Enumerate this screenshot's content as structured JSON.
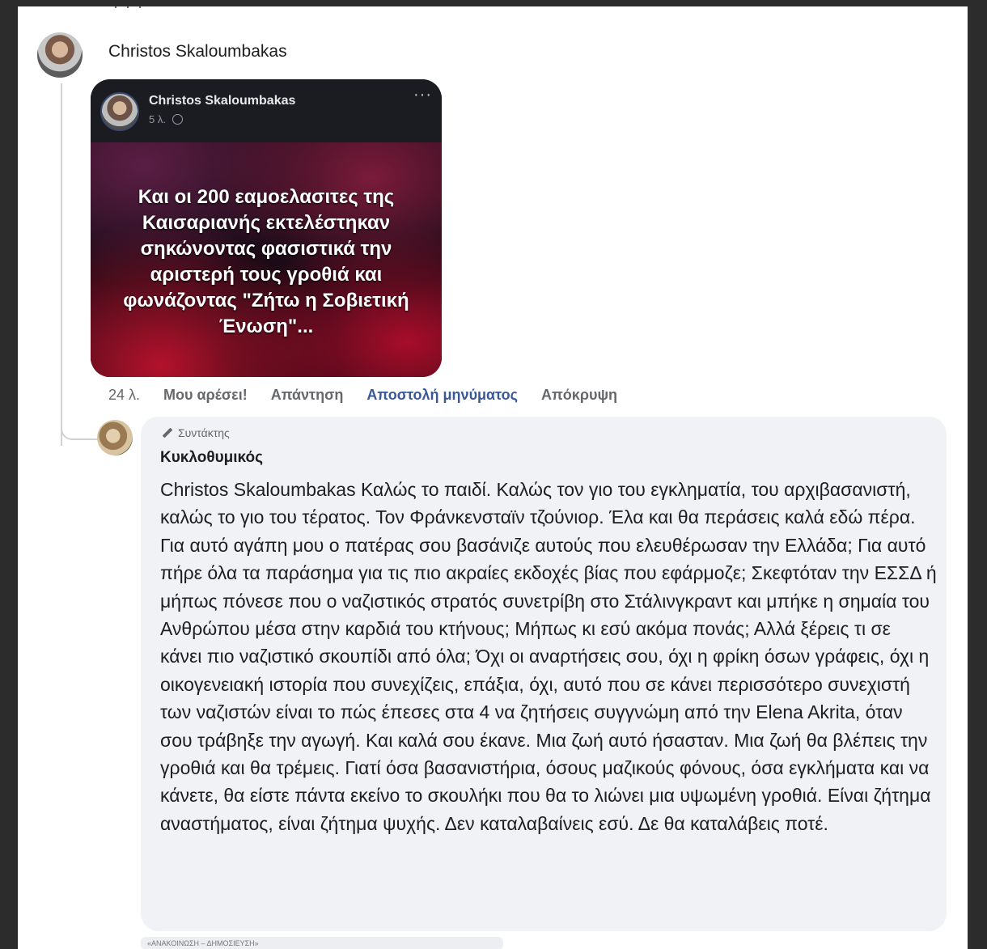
{
  "top_fragment": "· ·  ·",
  "comment": {
    "author": "Christos Skaloumbakas",
    "shared_post": {
      "author": "Christos Skaloumbakas",
      "time": "5 λ.",
      "more": "···",
      "text": "Και οι 200 εαμοελασιτες της Καισαριανής εκτελέστηκαν σηκώνοντας φασιστικά την αριστερή τους γροθιά και φωνάζοντας \"Ζήτω η Σοβιετική Ένωση\"..."
    },
    "actions": {
      "time": "24 λ.",
      "like": "Μου αρέσει!",
      "reply": "Απάντηση",
      "send_message": "Αποστολή μηνύματος",
      "hide": "Απόκρυψη"
    }
  },
  "reply": {
    "badge": "Συντάκτης",
    "author": "Κυκλοθυμικός",
    "text": "Christos Skaloumbakas Καλώς το παιδί. Καλώς τον γιο του εγκληματία, του αρχιβασανιστή, καλώς το γιο του τέρατος. Τον Φράνκενσταϊν τζούνιορ. Έλα και θα περάσεις καλά εδώ πέρα. Για αυτό αγάπη μου ο πατέρας σου βασάνιζε αυτούς που ελευθέρωσαν την Ελλάδα; Για αυτό πήρε όλα τα παράσημα για τις πιο ακραίες εκδοχές βίας που εφάρμοζε; Σκεφτόταν την ΕΣΣΔ ή μήπως πόνεσε που ο ναζιστικός στρατός συνετρίβη στο Στάλινγκραντ και μπήκε η σημαία του Ανθρώπου μέσα στην καρδιά του κτήνους; Μήπως κι εσύ ακόμα πονάς; Αλλά ξέρεις τι σε κάνει πιο ναζιστικό σκουπίδι από όλα; Όχι οι αναρτήσεις σου, όχι η φρίκη όσων γράφεις, όχι η οικογενειακή ιστορία που συνεχίζεις, επάξια, όχι, αυτό που σε κάνει περισσότερο συνεχιστή των ναζιστών είναι το πώς έπεσες στα 4 να ζητήσεις συγγνώμη από την Elena Akrita, όταν σου τράβηξε την αγωγή. Και καλά σου έκανε. Μια ζωή αυτό ήσασταν. Μια ζωή θα βλέπεις την γροθιά και θα τρέμεις. Γιατί όσα βασανιστήρια, όσους μαζικούς φόνους, όσα εγκλήματα και να κάνετε, θα είστε πάντα εκείνο το σκουλήκι που θα το λιώνει μια υψωμένη γροθιά. Είναι ζήτημα αναστήματος, είναι ζήτημα ψυχής. Δεν καταλαβαίνεις εσύ. Δε θα καταλάβεις ποτέ."
  },
  "bottom_fragment": "«ΑΝΑΚΟΙΝΩΣΗ – ΔΗΜΟΣΙΕΥΣΗ»"
}
